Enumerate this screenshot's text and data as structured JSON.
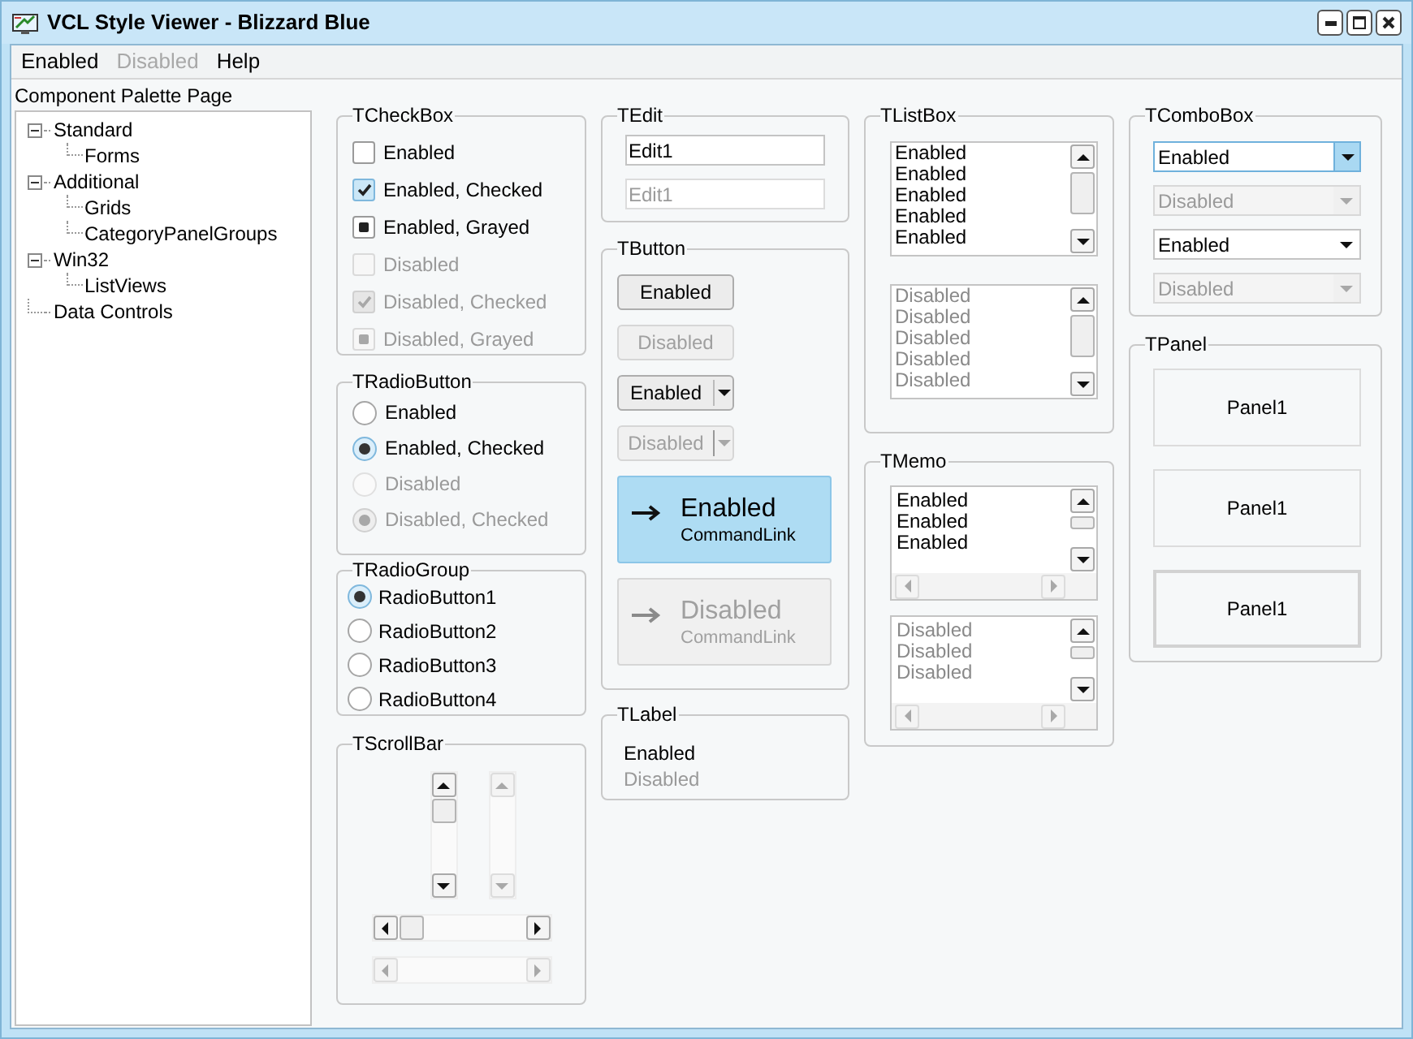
{
  "window": {
    "title": "VCL Style Viewer - Blizzard Blue"
  },
  "menu": [
    {
      "label": "Enabled",
      "disabled": false
    },
    {
      "label": "Disabled",
      "disabled": true
    },
    {
      "label": "Help",
      "disabled": false
    }
  ],
  "palette": {
    "label": "Component Palette Page",
    "tree": [
      {
        "label": "Standard",
        "expanded": true,
        "children": [
          {
            "label": "Forms"
          }
        ]
      },
      {
        "label": "Additional",
        "expanded": true,
        "children": [
          {
            "label": "Grids"
          },
          {
            "label": "CategoryPanelGroups"
          }
        ]
      },
      {
        "label": "Win32",
        "expanded": true,
        "children": [
          {
            "label": "ListViews"
          }
        ]
      },
      {
        "label": "Data Controls"
      }
    ]
  },
  "checkbox_group": {
    "title": "TCheckBox",
    "items": [
      {
        "label": "Enabled",
        "checked": false,
        "disabled": false
      },
      {
        "label": "Enabled, Checked",
        "checked": true,
        "disabled": false
      },
      {
        "label": "Enabled, Grayed",
        "grayed": true,
        "disabled": false
      },
      {
        "label": "Disabled",
        "checked": false,
        "disabled": true
      },
      {
        "label": "Disabled, Checked",
        "checked": true,
        "disabled": true
      },
      {
        "label": "Disabled, Grayed",
        "grayed": true,
        "disabled": true
      }
    ]
  },
  "radiobutton_group": {
    "title": "TRadioButton",
    "items": [
      {
        "label": "Enabled",
        "selected": false,
        "disabled": false
      },
      {
        "label": "Enabled, Checked",
        "selected": true,
        "disabled": false
      },
      {
        "label": "Disabled",
        "selected": false,
        "disabled": true
      },
      {
        "label": "Disabled, Checked",
        "selected": true,
        "disabled": true
      }
    ]
  },
  "radio_group": {
    "title": "TRadioGroup",
    "items": [
      {
        "label": "RadioButton1",
        "selected": true
      },
      {
        "label": "RadioButton2",
        "selected": false
      },
      {
        "label": "RadioButton3",
        "selected": false
      },
      {
        "label": "RadioButton4",
        "selected": false
      }
    ]
  },
  "scrollbar_group": {
    "title": "TScrollBar",
    "vertical_scrollbars": [
      {
        "disabled": false
      },
      {
        "disabled": true
      }
    ],
    "horizontal_scrollbars": [
      {
        "disabled": false
      },
      {
        "disabled": true
      }
    ]
  },
  "edit_group": {
    "title": "TEdit",
    "fields": [
      {
        "value": "Edit1",
        "disabled": false
      },
      {
        "value": "Edit1",
        "disabled": true
      }
    ]
  },
  "button_group": {
    "title": "TButton",
    "buttons": [
      {
        "kind": "push",
        "label": "Enabled",
        "disabled": false
      },
      {
        "kind": "push",
        "label": "Disabled",
        "disabled": true
      },
      {
        "kind": "split",
        "label": "Enabled",
        "disabled": false
      },
      {
        "kind": "split",
        "label": "Disabled",
        "disabled": true
      },
      {
        "kind": "command_link",
        "label": "Enabled",
        "note": "CommandLink",
        "disabled": false
      },
      {
        "kind": "command_link",
        "label": "Disabled",
        "note": "CommandLink",
        "disabled": true
      }
    ]
  },
  "label_group": {
    "title": "TLabel",
    "labels": [
      {
        "text": "Enabled",
        "disabled": false
      },
      {
        "text": "Disabled",
        "disabled": true
      }
    ]
  },
  "listbox_group": {
    "title": "TListBox",
    "lists": [
      {
        "disabled": false,
        "items": [
          "Enabled",
          "Enabled",
          "Enabled",
          "Enabled",
          "Enabled"
        ]
      },
      {
        "disabled": true,
        "items": [
          "Disabled",
          "Disabled",
          "Disabled",
          "Disabled",
          "Disabled"
        ]
      }
    ]
  },
  "memo_group": {
    "title": "TMemo",
    "memos": [
      {
        "disabled": false,
        "lines": [
          "Enabled",
          "Enabled",
          "Enabled"
        ]
      },
      {
        "disabled": true,
        "lines": [
          "Disabled",
          "Disabled",
          "Disabled"
        ]
      }
    ]
  },
  "combobox_group": {
    "title": "TComboBox",
    "combos": [
      {
        "value": "Enabled",
        "disabled": false,
        "focused": true
      },
      {
        "value": "Disabled",
        "disabled": true,
        "focused": false
      },
      {
        "value": "Enabled",
        "disabled": false,
        "focused": false
      },
      {
        "value": "Disabled",
        "disabled": true,
        "focused": false
      }
    ]
  },
  "panel_group": {
    "title": "TPanel",
    "panels": [
      {
        "caption": "Panel1",
        "kind": "flat"
      },
      {
        "caption": "Panel1",
        "kind": "flat"
      },
      {
        "caption": "Panel1",
        "kind": "raised"
      }
    ]
  }
}
